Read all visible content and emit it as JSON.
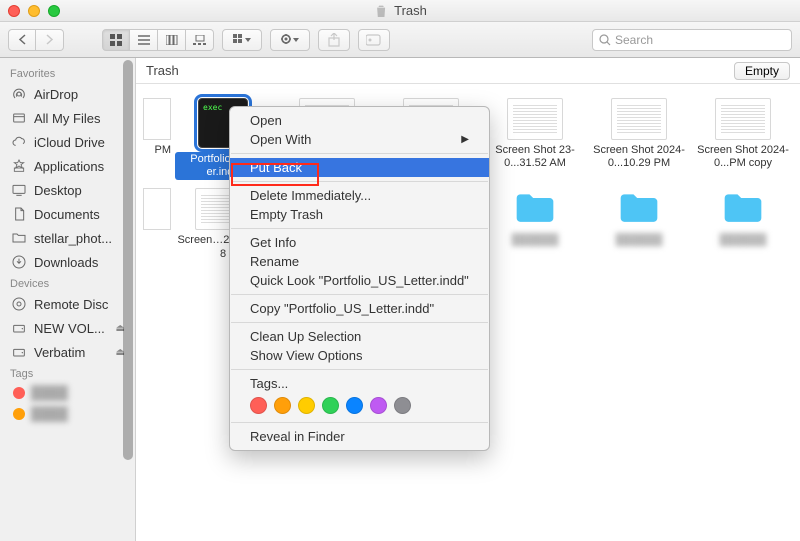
{
  "window": {
    "title": "Trash"
  },
  "toolbar": {
    "search_placeholder": "Search"
  },
  "sidebar": {
    "favorites_header": "Favorites",
    "favorites": [
      {
        "label": "AirDrop",
        "icon": "airdrop"
      },
      {
        "label": "All My Files",
        "icon": "allfiles"
      },
      {
        "label": "iCloud Drive",
        "icon": "cloud"
      },
      {
        "label": "Applications",
        "icon": "apps"
      },
      {
        "label": "Desktop",
        "icon": "desktop"
      },
      {
        "label": "Documents",
        "icon": "documents"
      },
      {
        "label": "stellar_phot...",
        "icon": "folder"
      },
      {
        "label": "Downloads",
        "icon": "downloads"
      }
    ],
    "devices_header": "Devices",
    "devices": [
      {
        "label": "Remote Disc",
        "icon": "disc",
        "eject": false
      },
      {
        "label": "NEW VOL...",
        "icon": "drive",
        "eject": true
      },
      {
        "label": "Verbatim",
        "icon": "drive",
        "eject": true
      }
    ],
    "tags_header": "Tags",
    "tags": [
      {
        "color": "#ff5f57"
      },
      {
        "color": "#ff9f0a"
      }
    ]
  },
  "path": {
    "location": "Trash",
    "empty_button": "Empty"
  },
  "files": {
    "row1_partial": {
      "thumb": true,
      "name": "PM"
    },
    "row1": [
      {
        "name": "Portfolio_U…er.indd",
        "type": "exec",
        "selected": true
      },
      {
        "name": "",
        "type": "doc"
      },
      {
        "name": "",
        "type": "doc"
      },
      {
        "name": "Screen Shot 23-0...31.52 AM",
        "type": "doc"
      },
      {
        "name": "Screen Shot 2024-0...10.29 PM",
        "type": "doc"
      },
      {
        "name": "Screen Shot 2024-0...PM copy",
        "type": "doc"
      }
    ],
    "row2_partial": {
      "thumb": true,
      "name": ""
    },
    "row2": [
      {
        "name": "Screen…2024-0…8",
        "type": "doc"
      },
      {
        "name": "",
        "type": "hidden"
      },
      {
        "name": "",
        "type": "hidden"
      },
      {
        "name": "blur1",
        "type": "folder"
      },
      {
        "name": "blur2",
        "type": "folder"
      },
      {
        "name": "blur3",
        "type": "folder"
      }
    ]
  },
  "context_menu": {
    "items": [
      {
        "label": "Open",
        "type": "item"
      },
      {
        "label": "Open With",
        "type": "submenu"
      },
      {
        "type": "sep"
      },
      {
        "label": "Put Back",
        "type": "item",
        "highlighted": true
      },
      {
        "type": "sep"
      },
      {
        "label": "Delete Immediately...",
        "type": "item"
      },
      {
        "label": "Empty Trash",
        "type": "item"
      },
      {
        "type": "sep"
      },
      {
        "label": "Get Info",
        "type": "item"
      },
      {
        "label": "Rename",
        "type": "item"
      },
      {
        "label": "Quick Look \"Portfolio_US_Letter.indd\"",
        "type": "item"
      },
      {
        "type": "sep"
      },
      {
        "label": "Copy \"Portfolio_US_Letter.indd\"",
        "type": "item"
      },
      {
        "type": "sep"
      },
      {
        "label": "Clean Up Selection",
        "type": "item"
      },
      {
        "label": "Show View Options",
        "type": "item"
      },
      {
        "type": "sep"
      },
      {
        "label": "Tags...",
        "type": "item"
      }
    ],
    "tag_colors": [
      "#ff5f57",
      "#ff9f0a",
      "#ffcc00",
      "#30d158",
      "#0a84ff",
      "#bf5af2",
      "#8e8e93"
    ]
  }
}
